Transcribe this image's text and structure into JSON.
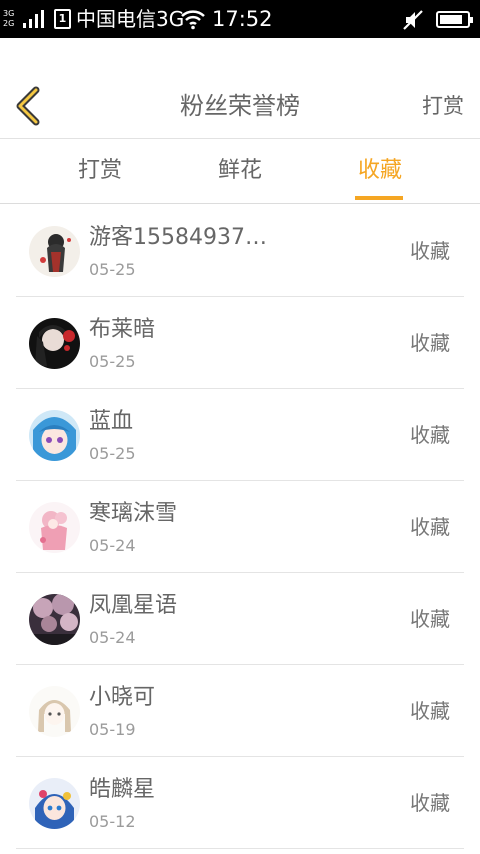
{
  "status_bar": {
    "network_top": "3G",
    "network_bottom": "2G",
    "sim_label": "1",
    "carrier": "中国电信3G",
    "time": "17:52",
    "battery_level": 0.85
  },
  "header": {
    "title": "粉丝荣誉榜",
    "right_action": "打赏",
    "back_icon": "chevron-left-icon",
    "accent_color": "#f5a623"
  },
  "tabs": [
    {
      "label": "打赏",
      "active": false
    },
    {
      "label": "鲜花",
      "active": false
    },
    {
      "label": "收藏",
      "active": true
    }
  ],
  "fans": [
    {
      "name": "游客15584937…",
      "date": "05-25",
      "action": "收藏"
    },
    {
      "name": "布莱暗",
      "date": "05-25",
      "action": "收藏"
    },
    {
      "name": "蓝血",
      "date": "05-25",
      "action": "收藏"
    },
    {
      "name": "寒璃沫雪",
      "date": "05-24",
      "action": "收藏"
    },
    {
      "name": "凤凰星语",
      "date": "05-24",
      "action": "收藏"
    },
    {
      "name": "小晓可",
      "date": "05-19",
      "action": "收藏"
    },
    {
      "name": "皓麟星",
      "date": "05-12",
      "action": "收藏"
    }
  ]
}
